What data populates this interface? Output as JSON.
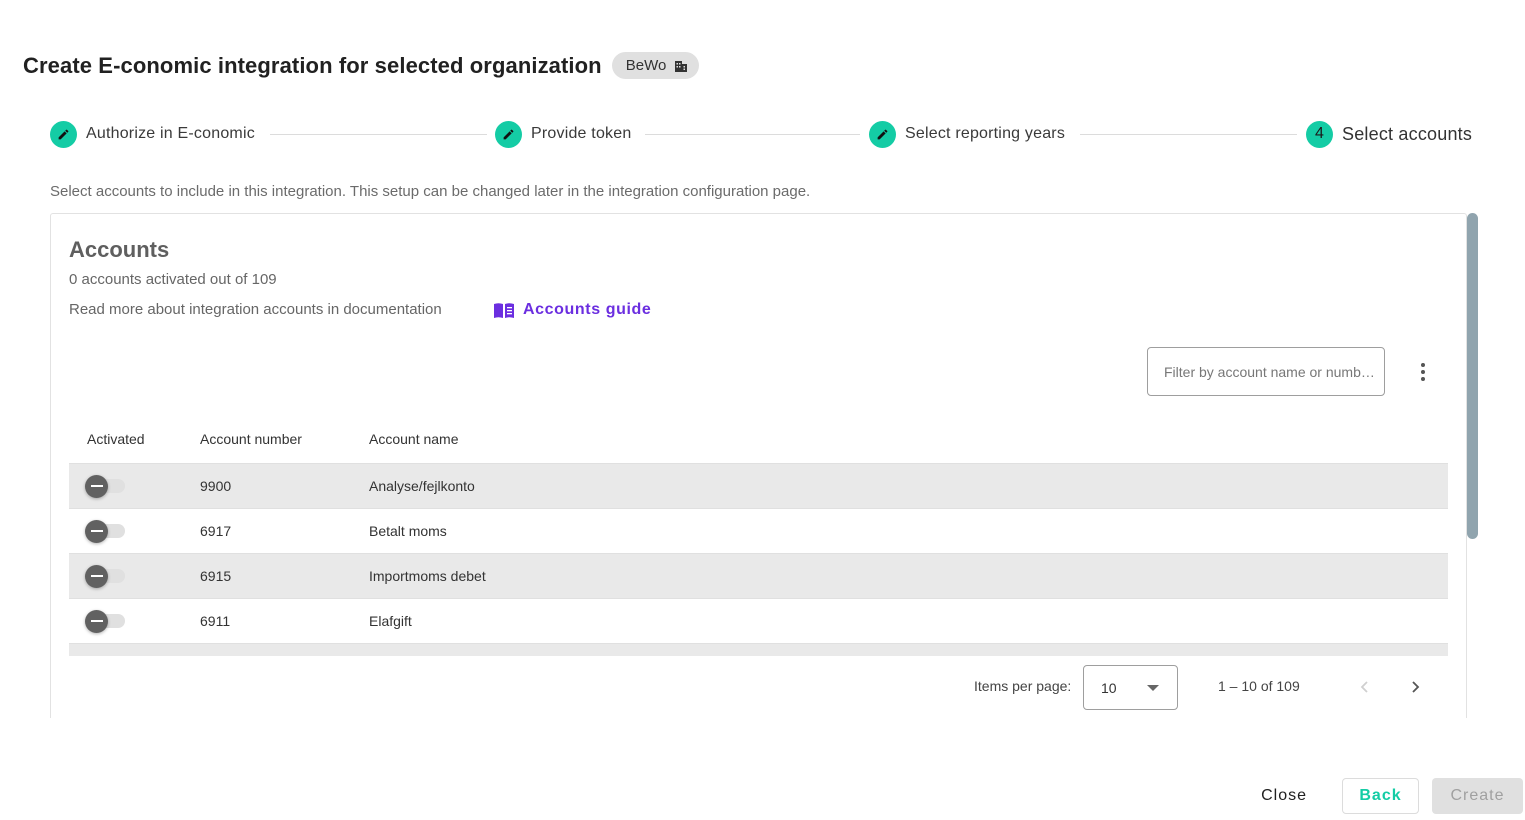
{
  "header": {
    "title": "Create E-conomic integration for selected organization",
    "organization_chip": {
      "label": "BeWo",
      "icon": "building-icon"
    }
  },
  "stepper": {
    "steps": [
      {
        "label": "Authorize in E-conomic",
        "state": "completed",
        "icon": "pencil-icon"
      },
      {
        "label": "Provide token",
        "state": "completed",
        "icon": "pencil-icon"
      },
      {
        "label": "Select reporting years",
        "state": "completed",
        "icon": "pencil-icon"
      },
      {
        "label": "Select accounts",
        "state": "active",
        "number": "4"
      }
    ]
  },
  "description": "Select accounts to include in this integration. This setup can be changed later in the integration configuration page.",
  "accounts_panel": {
    "title": "Accounts",
    "activated_summary": "0 accounts activated out of 109",
    "documentation_text": "Read more about integration accounts in documentation",
    "guide_link": {
      "label": "Accounts guide",
      "icon": "book-icon"
    },
    "filter": {
      "placeholder": "Filter by account name or numb…",
      "value": ""
    },
    "menu_icon": "more-vert-icon",
    "table": {
      "columns": [
        "Activated",
        "Account number",
        "Account name"
      ],
      "rows": [
        {
          "activated": false,
          "number": "9900",
          "name": "Analyse/fejlkonto"
        },
        {
          "activated": false,
          "number": "6917",
          "name": "Betalt moms"
        },
        {
          "activated": false,
          "number": "6915",
          "name": "Importmoms debet"
        },
        {
          "activated": false,
          "number": "6911",
          "name": "Elafgift"
        }
      ]
    },
    "paginator": {
      "items_per_page_label": "Items per page:",
      "items_per_page": "10",
      "range_label": "1 – 10 of 109",
      "prev_icon": "chevron-left-icon",
      "next_icon": "chevron-right-icon"
    }
  },
  "footer": {
    "close_label": "Close",
    "back_label": "Back",
    "create_label": "Create"
  },
  "colors": {
    "accent": "#14cca5",
    "link": "#6b2ee0",
    "scrollbar": "#90a4ae"
  }
}
